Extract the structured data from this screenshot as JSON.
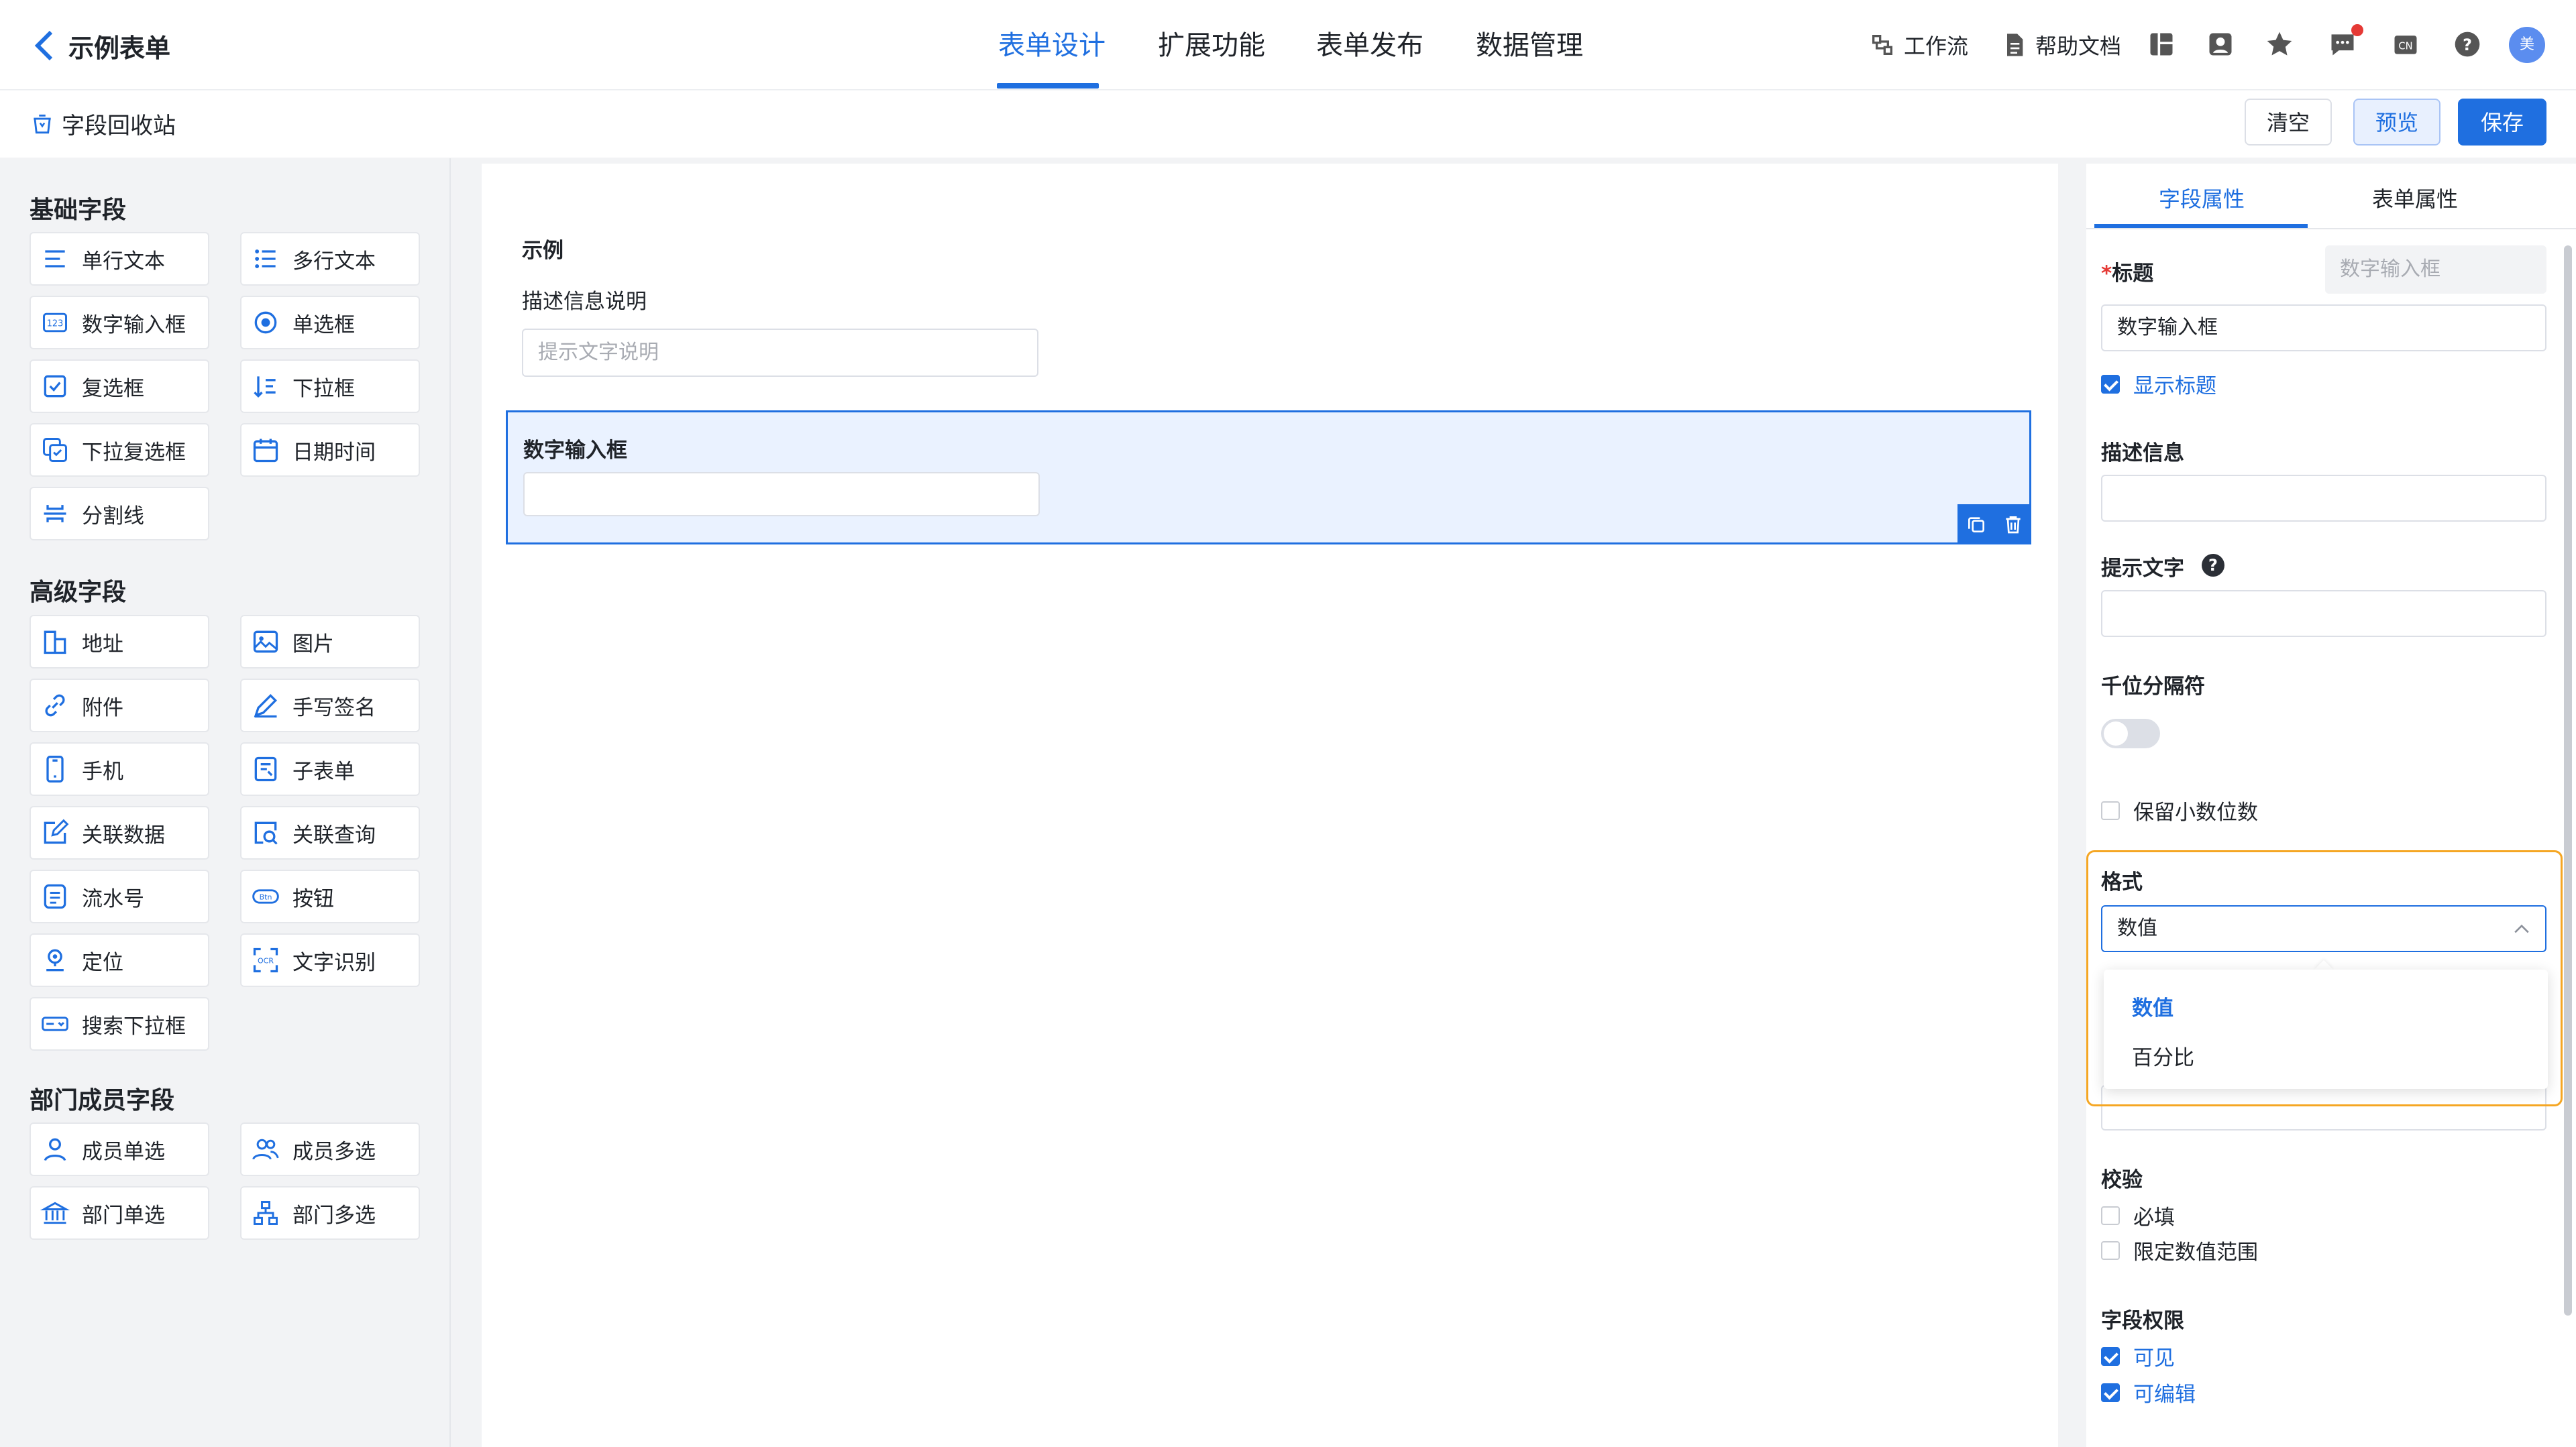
{
  "header": {
    "back_title": "示例表单",
    "tabs": [
      "表单设计",
      "扩展功能",
      "表单发布",
      "数据管理"
    ],
    "tools": {
      "workflow": "工作流",
      "help_docs": "帮助文档"
    },
    "avatar_text": "美"
  },
  "subbar": {
    "recycle": "字段回收站",
    "clear": "清空",
    "preview": "预览",
    "save": "保存"
  },
  "palette": {
    "basic_title": "基础字段",
    "basic": [
      "单行文本",
      "多行文本",
      "数字输入框",
      "单选框",
      "复选框",
      "下拉框",
      "下拉复选框",
      "日期时间",
      "分割线"
    ],
    "advanced_title": "高级字段",
    "advanced": [
      "地址",
      "图片",
      "附件",
      "手写签名",
      "手机",
      "子表单",
      "关联数据",
      "关联查询",
      "流水号",
      "按钮",
      "定位",
      "文字识别",
      "搜索下拉框"
    ],
    "dept_title": "部门成员字段",
    "dept": [
      "成员单选",
      "成员多选",
      "部门单选",
      "部门多选"
    ]
  },
  "canvas": {
    "form_title": "示例",
    "form_desc": "描述信息说明",
    "form_hint": "提示文字说明",
    "selected_field_label": "数字输入框"
  },
  "props": {
    "tab_field": "字段属性",
    "tab_form": "表单属性",
    "title_label": "标题",
    "required_mark": "*",
    "title_placeholder": "数字输入框",
    "title_value": "数字输入框",
    "show_title": "显示标题",
    "desc_label": "描述信息",
    "hint_label": "提示文字",
    "thousands_label": "千位分隔符",
    "keep_decimal": "保留小数位数",
    "format_label": "格式",
    "format_value": "数值",
    "format_options": [
      "数值",
      "百分比"
    ],
    "validate_label": "校验",
    "required": "必填",
    "range": "限定数值范围",
    "perm_label": "字段权限",
    "visible": "可见",
    "editable": "可编辑"
  },
  "colors": {
    "accent": "#1f6fe0",
    "highlight": "#f5a623",
    "selected_bg": "#eaf2ff"
  }
}
